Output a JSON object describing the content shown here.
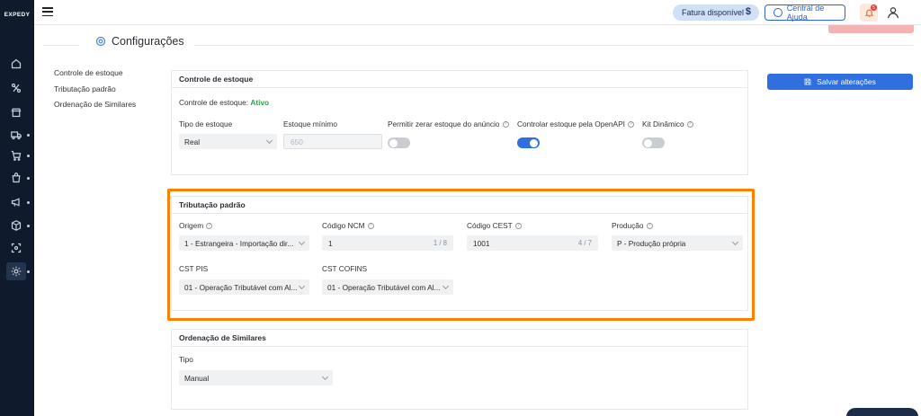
{
  "app": {
    "logo": "EXPEDY"
  },
  "topbar": {
    "fatura_label": "Fatura disponível",
    "fatura_icon": "$",
    "help_label": "Central de Ajuda",
    "notifications_count": "5"
  },
  "page": {
    "title": "Configurações"
  },
  "left_menu": [
    "Controle de estoque",
    "Tributação padrão",
    "Ordenação de Similares"
  ],
  "save_button": "Salvar alterações",
  "estoque": {
    "title": "Controle de estoque",
    "status_label": "Controle de estoque:",
    "status_value": "Ativo",
    "tipo_label": "Tipo de estoque",
    "tipo_value": "Real",
    "minimo_label": "Estoque mínimo",
    "minimo_value": "650",
    "permitir_label": "Permitir zerar estoque do anúncio",
    "permitir_on": false,
    "openapi_label": "Controlar estoque pela OpenAPI",
    "openapi_on": true,
    "kit_label": "Kit Dinâmico",
    "kit_on": false
  },
  "tributacao": {
    "title": "Tributação padrão",
    "origem_label": "Origem",
    "origem_value": "1 - Estrangeira - Importação dir...",
    "ncm_label": "Código NCM",
    "ncm_value": "1",
    "ncm_count": "1 / 8",
    "cest_label": "Código CEST",
    "cest_value": "1001",
    "cest_count": "4 / 7",
    "producao_label": "Produção",
    "producao_value": "P - Produção própria",
    "pis_label": "CST PIS",
    "pis_value": "01 - Operação Tributável com Al...",
    "cofins_label": "CST COFINS",
    "cofins_value": "01 - Operação Tributável com Al..."
  },
  "similares": {
    "title": "Ordenação de Similares",
    "tipo_label": "Tipo",
    "tipo_value": "Manual"
  },
  "colors": {
    "accent": "#2f6fe0",
    "sidebar": "#0f1b2d",
    "highlight": "#ff8000",
    "active_text": "#2ea44f"
  }
}
